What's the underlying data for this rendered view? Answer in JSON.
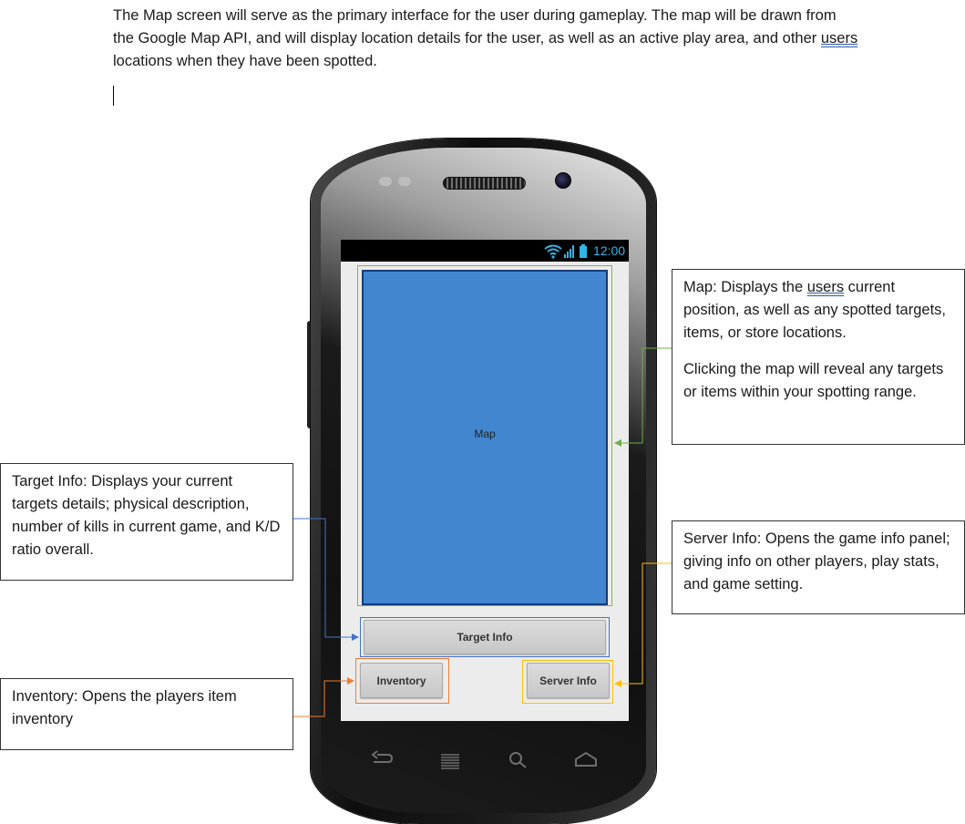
{
  "intro": {
    "part1": "The Map screen will serve as the primary interface for the user during gameplay. The map will be drawn from the Google Map API, and will display location details for the user, as well as an active play area, and other ",
    "users_word": "users",
    "part2": " locations when they have been spotted."
  },
  "phone": {
    "status_time": "12:00",
    "map_label": "Map",
    "target_info_button": "Target Info",
    "inventory_button": "Inventory",
    "server_info_button": "Server Info",
    "softkeys": [
      "back-icon",
      "menu-icon",
      "search-icon",
      "home-icon"
    ]
  },
  "annotations": {
    "map_note": {
      "p1_before": "Map: Displays the ",
      "p1_users": "users",
      "p1_after": " current position, as well as any spotted targets, items, or store locations.",
      "p2": "Clicking the map will reveal any targets or items within your spotting range."
    },
    "target_note": "Target Info: Displays your current targets details; physical description, number of kills in current game, and K/D ratio overall.",
    "server_note": "Server Info: Opens the game info panel; giving info on other players, play stats, and game setting.",
    "inventory_note": "Inventory: Opens the players item inventory"
  },
  "colors": {
    "map_fill": "#4286d0",
    "map_outline": "#7ab55c",
    "target_outline": "#4472c4",
    "inventory_outline": "#ed7d31",
    "server_outline": "#ffc000",
    "status_accent": "#33b5e5"
  }
}
